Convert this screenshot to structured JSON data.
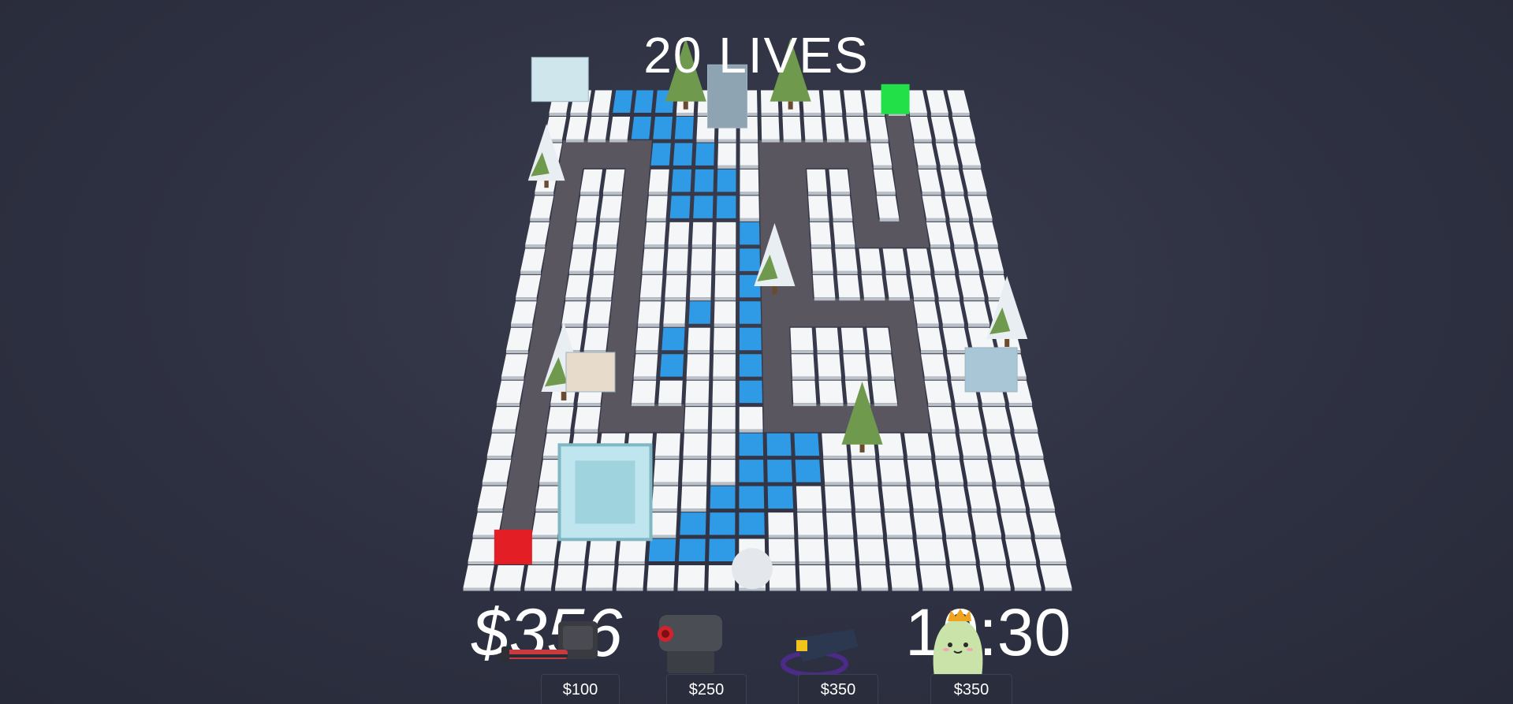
{
  "hud": {
    "lives_text": "20 LIVES",
    "money_text": "$356",
    "timer_text": "10:30"
  },
  "shop": {
    "items": [
      {
        "icon": "gatling-turret-icon",
        "price": "$100"
      },
      {
        "icon": "cannon-turret-icon",
        "price": "$250"
      },
      {
        "icon": "tesla-turret-icon",
        "price": "$350"
      },
      {
        "icon": "ghost-king-turret-icon",
        "price": "$350"
      }
    ]
  },
  "board": {
    "theme": "snow",
    "colors": {
      "snow_tile": "#f4f6f8",
      "water_tile": "#2f9be6",
      "path": "#5a5660",
      "spawn": "#e41e25",
      "goal": "#22e048",
      "tree": "#6f9a4e",
      "background": "#2e3142"
    }
  }
}
